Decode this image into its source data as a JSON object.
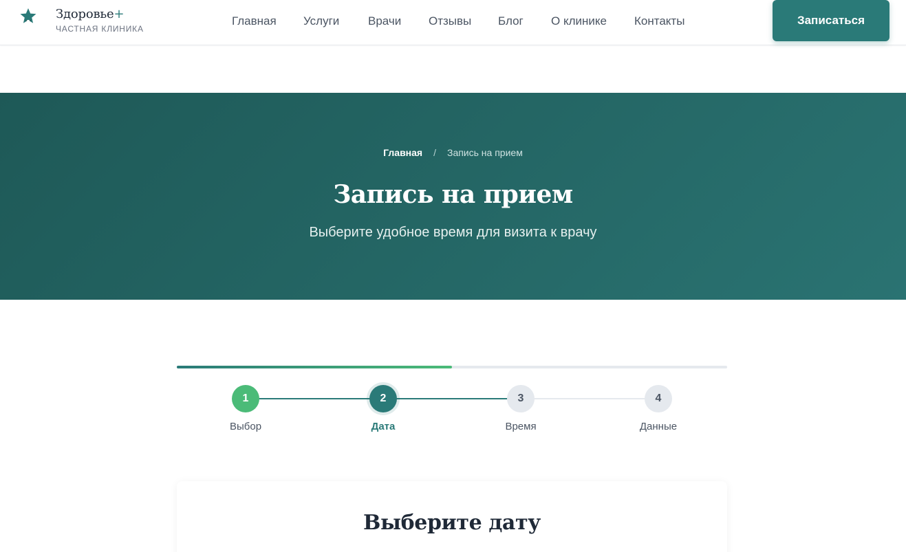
{
  "header": {
    "brand_name": "Здоровье",
    "brand_plus": "+",
    "brand_sub": "ЧАСТНАЯ КЛИНИКА",
    "logo_icon": "star-shield-icon",
    "nav": [
      {
        "label": "Главная"
      },
      {
        "label": "Услуги"
      },
      {
        "label": "Врачи"
      },
      {
        "label": "Отзывы"
      },
      {
        "label": "Блог"
      },
      {
        "label": "О клинике"
      },
      {
        "label": "Контакты"
      }
    ],
    "cta_label": "Записаться"
  },
  "hero": {
    "breadcrumb": {
      "home": "Главная",
      "separator": "/",
      "current": "Запись на прием"
    },
    "title": "Запись на прием",
    "subtitle": "Выберите удобное время для визита к врачу"
  },
  "progress": {
    "fraction": 0.5,
    "steps": [
      {
        "number": "1",
        "label": "Выбор",
        "state": "done"
      },
      {
        "number": "2",
        "label": "Дата",
        "state": "active"
      },
      {
        "number": "3",
        "label": "Время",
        "state": "pending"
      },
      {
        "number": "4",
        "label": "Данные",
        "state": "pending"
      }
    ]
  },
  "card": {
    "title": "Выберите дату"
  },
  "colors": {
    "primary": "#2a7a78",
    "success": "#4bbb78",
    "hero_start": "#1e5957",
    "hero_end": "#2a7372",
    "muted": "#e5e9ee"
  }
}
